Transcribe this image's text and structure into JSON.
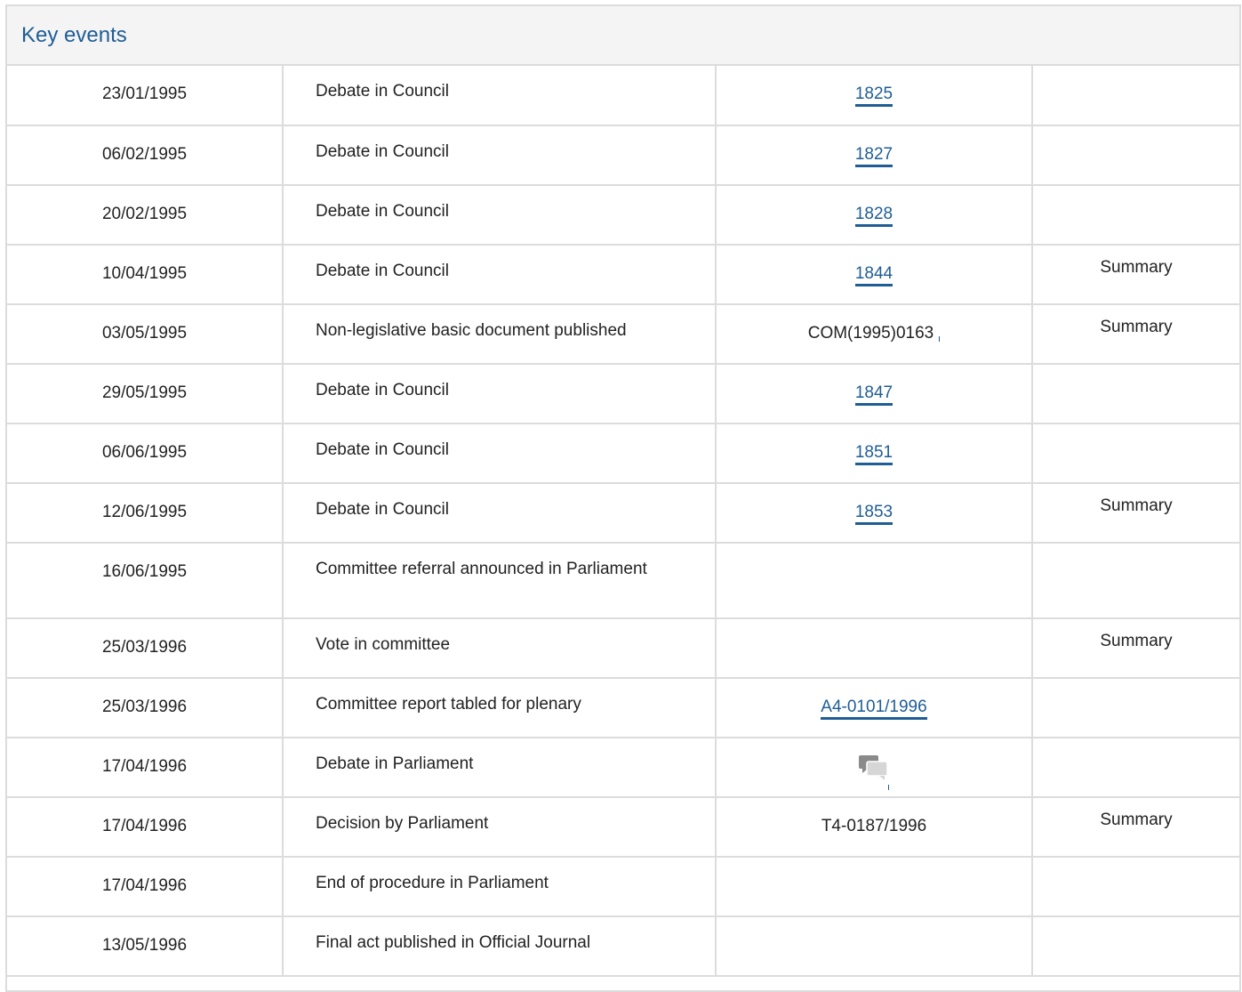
{
  "panel": {
    "title": "Key events"
  },
  "events": [
    {
      "date": "23/01/1995",
      "event": "Debate in Council",
      "ref": "1825",
      "ref_type": "link",
      "summary": ""
    },
    {
      "date": "06/02/1995",
      "event": "Debate in Council",
      "ref": "1827",
      "ref_type": "link",
      "summary": ""
    },
    {
      "date": "20/02/1995",
      "event": "Debate in Council",
      "ref": "1828",
      "ref_type": "link",
      "summary": ""
    },
    {
      "date": "10/04/1995",
      "event": "Debate in Council",
      "ref": "1844",
      "ref_type": "link",
      "summary": "Summary"
    },
    {
      "date": "03/05/1995",
      "event": "Non-legislative basic document published",
      "ref": "COM(1995)0163",
      "ref_type": "text-com",
      "summary": "Summary"
    },
    {
      "date": "29/05/1995",
      "event": "Debate in Council",
      "ref": "1847",
      "ref_type": "link",
      "summary": ""
    },
    {
      "date": "06/06/1995",
      "event": "Debate in Council",
      "ref": "1851",
      "ref_type": "link",
      "summary": ""
    },
    {
      "date": "12/06/1995",
      "event": "Debate in Council",
      "ref": "1853",
      "ref_type": "link",
      "summary": "Summary"
    },
    {
      "date": "16/06/1995",
      "event": "Committee referral announced in Parliament",
      "ref": "",
      "ref_type": "none",
      "summary": ""
    },
    {
      "date": "25/03/1996",
      "event": "Vote in committee",
      "ref": "",
      "ref_type": "none",
      "summary": "Summary"
    },
    {
      "date": "25/03/1996",
      "event": "Committee report tabled for plenary",
      "ref": "A4-0101/1996",
      "ref_type": "link",
      "summary": ""
    },
    {
      "date": "17/04/1996",
      "event": "Debate in Parliament",
      "ref": "",
      "ref_type": "icon",
      "icon": "debate-speech-bubbles-icon",
      "summary": ""
    },
    {
      "date": "17/04/1996",
      "event": "Decision by Parliament",
      "ref": "T4-0187/1996",
      "ref_type": "text",
      "summary": "Summary"
    },
    {
      "date": "17/04/1996",
      "event": "End of procedure in Parliament",
      "ref": "",
      "ref_type": "none",
      "summary": ""
    },
    {
      "date": "13/05/1996",
      "event": "Final act published in Official Journal",
      "ref": "",
      "ref_type": "none",
      "summary": ""
    }
  ],
  "colors": {
    "link": "#1f5d95",
    "border": "#dcdcdc",
    "header_bg": "#f4f4f4",
    "text": "#222222"
  }
}
